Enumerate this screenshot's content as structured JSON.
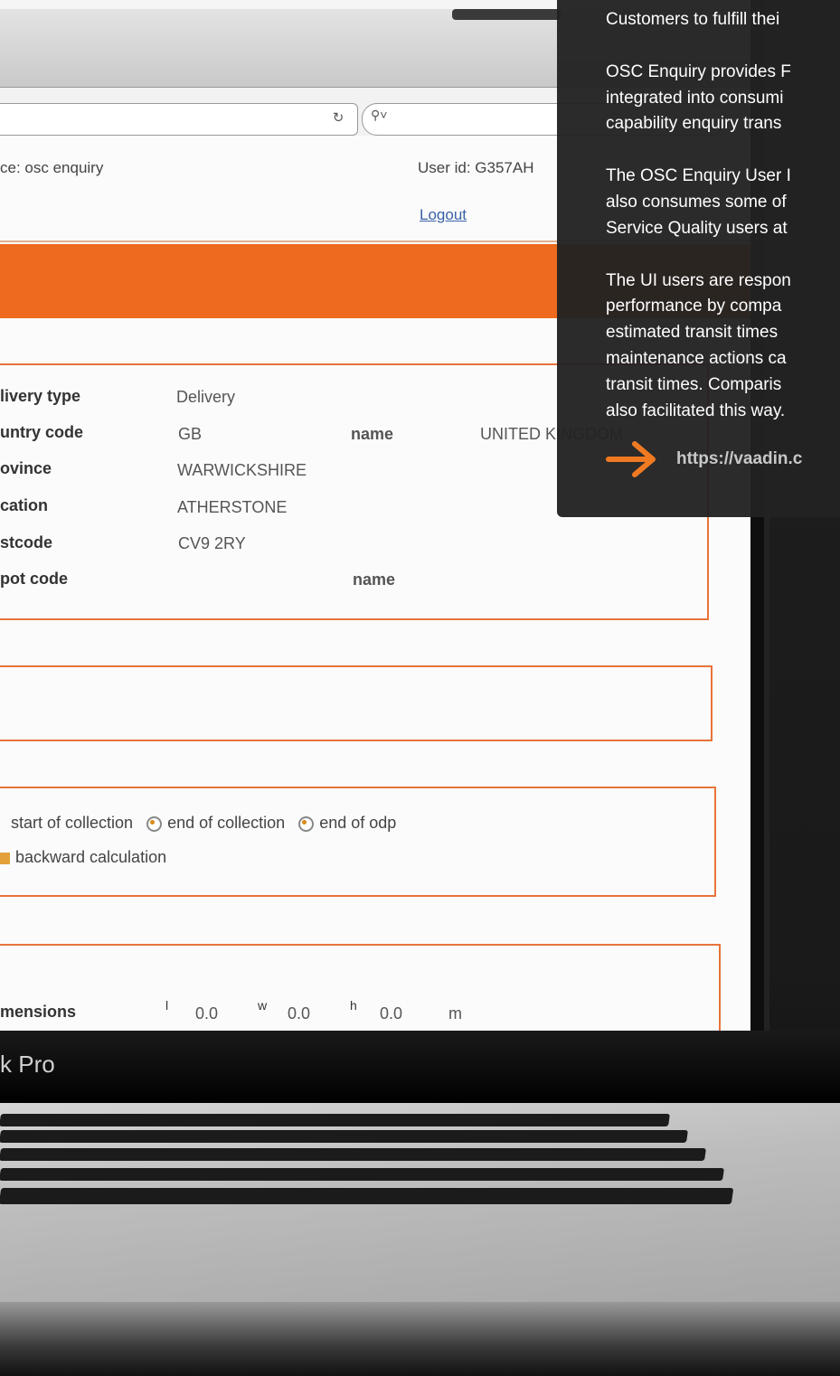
{
  "overlay": {
    "lines": [
      "Customers to fulfill thei",
      "",
      "OSC Enquiry provides F",
      "integrated into consumi",
      "capability enquiry trans",
      "",
      "The OSC Enquiry User I",
      "also consumes some of",
      "Service Quality users at",
      "",
      "The UI users are respon",
      "performance by compa",
      "estimated transit times",
      "maintenance actions ca",
      "transit times. Comparis",
      "also facilitated this way."
    ],
    "link": "https://vaadin.c"
  },
  "browser": {
    "service_label": "ce: osc enquiry",
    "user_id": "User id: G357AH",
    "logout": "Logout"
  },
  "address_fields": [
    {
      "label": "livery type",
      "value": "Delivery"
    },
    {
      "label": "untry code",
      "value": "GB"
    },
    {
      "label": "ovince",
      "value": "WARWICKSHIRE"
    },
    {
      "label": "cation",
      "value": "ATHERSTONE"
    },
    {
      "label": "stcode",
      "value": "CV9 2RY"
    },
    {
      "label": "pot code",
      "value": ""
    }
  ],
  "name_labels": [
    "name",
    "name"
  ],
  "country_name": "UNITED KINGDOM",
  "options": {
    "start": "start of collection",
    "end": "end of collection",
    "odp": "end of odp",
    "backward": "backward calculation"
  },
  "dimensions": {
    "label": "mensions",
    "l_label": "l",
    "l_value": "0.0",
    "w_label": "w",
    "w_value": "0.0",
    "h_label": "h",
    "h_value": "0.0",
    "unit": "m"
  },
  "laptop": {
    "brand": "k Pro"
  },
  "colors": {
    "accent": "#ee6a1e",
    "overlay_bg": "#222222",
    "arrow": "#f07a22"
  }
}
